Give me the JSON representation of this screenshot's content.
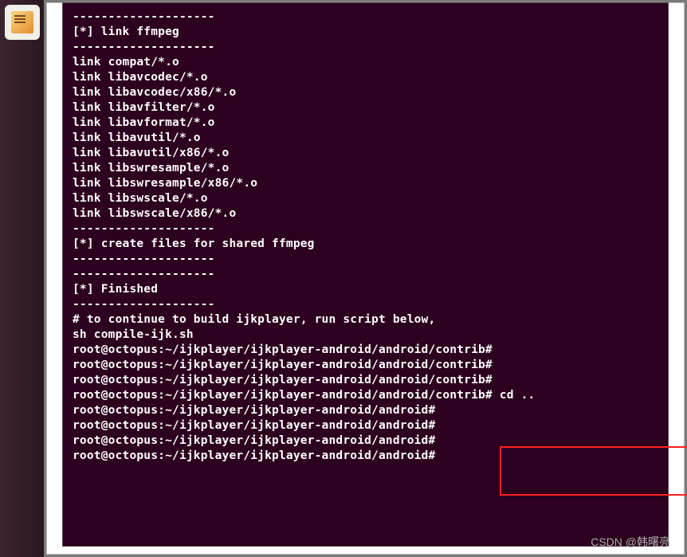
{
  "launcher": {
    "items": [
      {
        "name": "text-editor"
      }
    ]
  },
  "terminal": {
    "lines": [
      "--------------------",
      "[*] link ffmpeg",
      "--------------------",
      "",
      "link compat/*.o",
      "link libavcodec/*.o",
      "link libavcodec/x86/*.o",
      "link libavfilter/*.o",
      "link libavformat/*.o",
      "link libavutil/*.o",
      "link libavutil/x86/*.o",
      "link libswresample/*.o",
      "link libswresample/x86/*.o",
      "link libswscale/*.o",
      "link libswscale/x86/*.o",
      "",
      "--------------------",
      "[*] create files for shared ffmpeg",
      "--------------------",
      "",
      "",
      "--------------------",
      "[*] Finished",
      "--------------------",
      "# to continue to build ijkplayer, run script below,",
      "sh compile-ijk.sh",
      "root@octopus:~/ijkplayer/ijkplayer-android/android/contrib# ",
      "root@octopus:~/ijkplayer/ijkplayer-android/android/contrib# ",
      "root@octopus:~/ijkplayer/ijkplayer-android/android/contrib# ",
      "root@octopus:~/ijkplayer/ijkplayer-android/android/contrib# cd ..",
      "root@octopus:~/ijkplayer/ijkplayer-android/android# ",
      "root@octopus:~/ijkplayer/ijkplayer-android/android# ",
      "root@octopus:~/ijkplayer/ijkplayer-android/android# ",
      "root@octopus:~/ijkplayer/ijkplayer-android/android# "
    ]
  },
  "watermark": "CSDN @韩曙亮"
}
